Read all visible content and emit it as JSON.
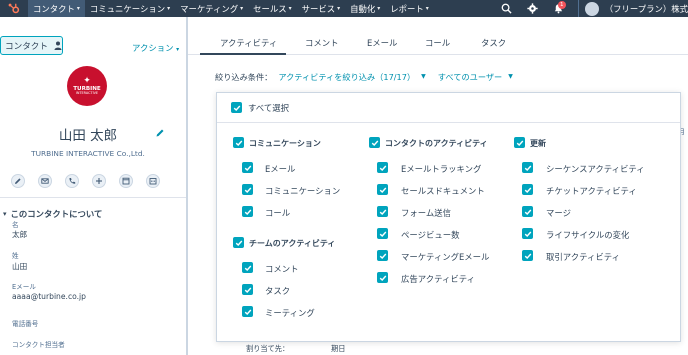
{
  "topnav": {
    "items": [
      "コンタクト",
      "コミュニケーション",
      "マーケティング",
      "セールス",
      "サービス",
      "自動化",
      "レポート"
    ],
    "notification_count": "1",
    "plan_label": "（フリープラン）株式"
  },
  "sidebar": {
    "record_type": "コンタクト",
    "actions_label": "アクション",
    "company_logo": {
      "line1": "TURBINE",
      "line2": "INTERACTIVE"
    },
    "contact_name": "山田 太郎",
    "company_name": "TURBINE INTERACTIVE Co.,Ltd.",
    "action_icons": [
      "edit-note-icon",
      "email-icon",
      "phone-icon",
      "plus-icon",
      "task-icon",
      "calendar-icon"
    ],
    "about_heading": "このコンタクトについて",
    "properties": [
      {
        "label": "名",
        "value": "太郎"
      },
      {
        "label": "姓",
        "value": "山田"
      },
      {
        "label": "Eメール",
        "value": "aaaa@turbine.co.jp"
      },
      {
        "label": "電話番号",
        "value": ""
      },
      {
        "label": "コンタクト担当者",
        "value": ""
      }
    ]
  },
  "main": {
    "tabs": [
      "アクティビティ",
      "コメント",
      "Eメール",
      "コール",
      "タスク"
    ],
    "active_tab": "アクティビティ",
    "filter_label": "絞り込み条件：",
    "filter_link": "アクティビティを絞り込み（17/17）",
    "users_link": "すべてのユーザー",
    "background_assign_label": "割り当て先：",
    "background_due_label": "期日",
    "right_edge_text": "月"
  },
  "filter_panel": {
    "select_all": "すべて選択",
    "columns": [
      {
        "groups": [
          {
            "heading": "コミュニケーション",
            "items": [
              "Eメール",
              "コミュニケーション",
              "コール"
            ]
          },
          {
            "heading": "チームのアクティビティ",
            "items": [
              "コメント",
              "タスク",
              "ミーティング"
            ]
          }
        ]
      },
      {
        "groups": [
          {
            "heading": "コンタクトのアクティビティ",
            "items": [
              "Eメールトラッキング",
              "セールスドキュメント",
              "フォーム送信",
              "ページビュー数",
              "マーケティングEメール",
              "広告アクティビティ"
            ]
          }
        ]
      },
      {
        "groups": [
          {
            "heading": "更新",
            "items": [
              "シーケンスアクティビティ",
              "チケットアクティビティ",
              "マージ",
              "ライフサイクルの変化",
              "取引アクティビティ"
            ]
          }
        ]
      }
    ]
  },
  "colors": {
    "nav_bg": "#2d3e50",
    "accent": "#00a4bd",
    "link": "#0091ae",
    "brand_red": "#c8102e"
  }
}
